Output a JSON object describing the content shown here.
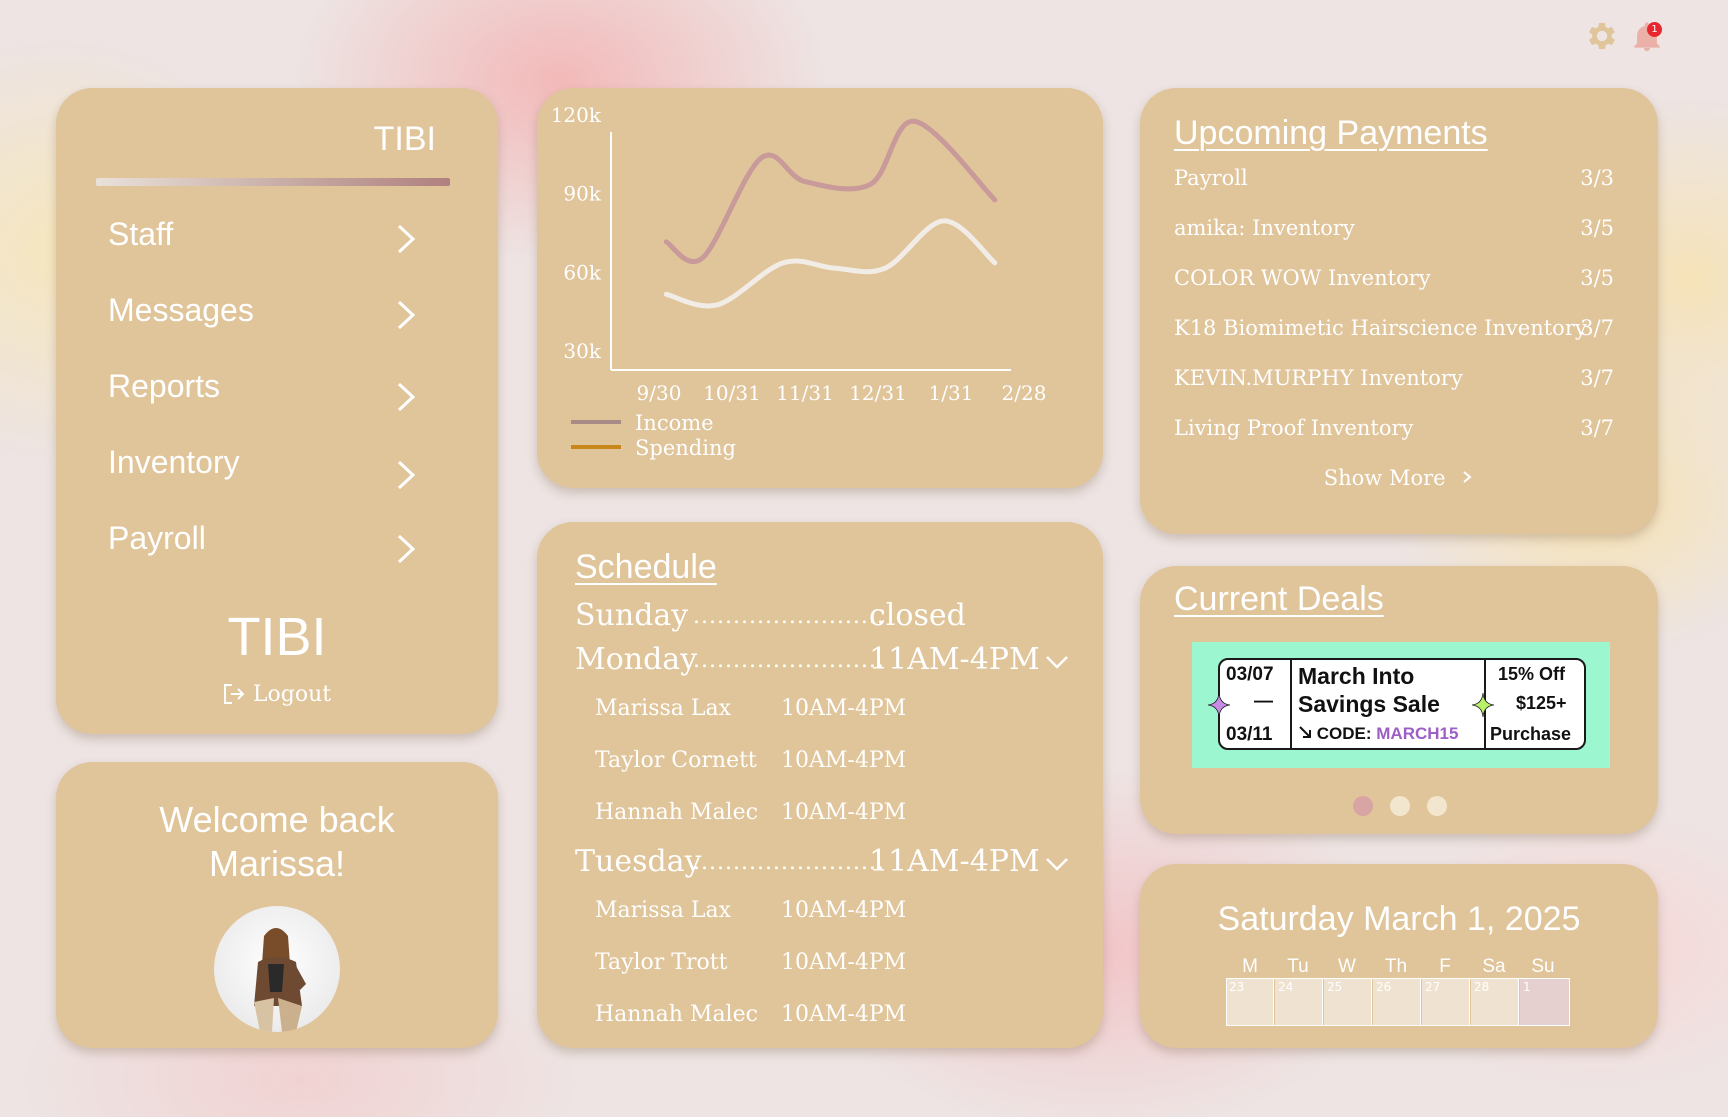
{
  "header": {
    "settings_icon": "gear-icon",
    "notifications_icon": "bell-icon",
    "notification_count": "1"
  },
  "nav": {
    "title": "TIBI",
    "items": [
      {
        "label": "Staff",
        "icon": "chevron-right-icon"
      },
      {
        "label": "Messages",
        "icon": "chevron-right-icon"
      },
      {
        "label": "Reports",
        "icon": "chevron-right-icon"
      },
      {
        "label": "Inventory",
        "icon": "chevron-right-icon"
      },
      {
        "label": "Payroll",
        "icon": "chevron-right-icon"
      }
    ],
    "brand": "TIBI",
    "logout_label": "Logout",
    "logout_icon": "logout-icon"
  },
  "welcome": {
    "line1": "Welcome back",
    "line2": "Marissa!",
    "avatar_icon": "avatar"
  },
  "chart_data": {
    "type": "line",
    "title": "",
    "xlabel": "",
    "ylabel": "",
    "x": [
      "9/30",
      "10/31",
      "11/31",
      "12/31",
      "1/31",
      "2/28"
    ],
    "y_ticks": [
      "30k",
      "60k",
      "90k",
      "120k"
    ],
    "ylim": [
      30000,
      120000
    ],
    "series": [
      {
        "name": "Income",
        "color": "#c89a9a",
        "legend_color": "#a88a86",
        "points": [
          [
            0.1,
            72000
          ],
          [
            0.6,
            66000
          ],
          [
            1.4,
            104000
          ],
          [
            2.0,
            95000
          ],
          [
            2.9,
            94000
          ],
          [
            3.5,
            118000
          ],
          [
            4.6,
            88000
          ]
        ]
      },
      {
        "name": "Spending",
        "color": "#f2ece6",
        "legend_color": "#c9861a",
        "points": [
          [
            0.1,
            52000
          ],
          [
            0.8,
            48000
          ],
          [
            1.7,
            64000
          ],
          [
            2.4,
            62000
          ],
          [
            3.1,
            62000
          ],
          [
            3.9,
            80000
          ],
          [
            4.6,
            64000
          ]
        ]
      }
    ],
    "legend_position": "bottom-left",
    "grid": false
  },
  "schedule": {
    "title": "Schedule",
    "days": [
      {
        "day": "Sunday",
        "dots": "........................",
        "hours": "closed",
        "staff": []
      },
      {
        "day": "Monday",
        "dots": "........................",
        "hours": "11AM-4PM",
        "expand_icon": "chevron-down-icon",
        "staff": [
          {
            "name": "Marissa Lax",
            "hours": "10AM-4PM"
          },
          {
            "name": "Taylor Cornett",
            "hours": "10AM-4PM"
          },
          {
            "name": "Hannah Malec",
            "hours": "10AM-4PM"
          }
        ]
      },
      {
        "day": "Tuesday",
        "dots": "........................",
        "hours": "11AM-4PM",
        "expand_icon": "chevron-down-icon",
        "staff": [
          {
            "name": "Marissa Lax",
            "hours": "10AM-4PM"
          },
          {
            "name": "Taylor Trott",
            "hours": "10AM-4PM"
          },
          {
            "name": "Hannah Malec",
            "hours": "10AM-4PM"
          }
        ]
      }
    ]
  },
  "payments": {
    "title": "Upcoming Payments",
    "items": [
      {
        "name": "Payroll",
        "date": "3/3"
      },
      {
        "name": "amika: Inventory",
        "date": "3/5"
      },
      {
        "name": "COLOR WOW Inventory",
        "date": "3/5"
      },
      {
        "name": "K18 Biomimetic Hairscience Inventory",
        "date": "3/7"
      },
      {
        "name": "KEVIN.MURPHY Inventory",
        "date": "3/7"
      },
      {
        "name": "Living Proof Inventory",
        "date": "3/7"
      }
    ],
    "show_more": "Show More",
    "show_more_icon": "chevron-right-icon"
  },
  "deals": {
    "title": "Current Deals",
    "banner_bg": "#9cf6cf",
    "start_date": "03/07",
    "dash": "—",
    "end_date": "03/11",
    "name_line1": "March Into",
    "name_line2": "Savings Sale",
    "code_label": "CODE:",
    "code": "MARCH15",
    "code_color": "#9b5fc6",
    "offer_line1": "15% Off",
    "offer_line2": "$125+",
    "offer_line3": "Purchase",
    "carousel": {
      "count": 3,
      "active": 0,
      "active_color": "#d8a4a4",
      "inactive_color": "#f3e6cf"
    }
  },
  "calendar": {
    "title": "Saturday March 1, 2025",
    "weekdays": [
      "M",
      "Tu",
      "W",
      "Th",
      "F",
      "Sa",
      "Su"
    ],
    "days": [
      "23",
      "24",
      "25",
      "26",
      "27",
      "28",
      "1"
    ],
    "selected_day": "1",
    "selected_color": "#e6cfcf"
  }
}
